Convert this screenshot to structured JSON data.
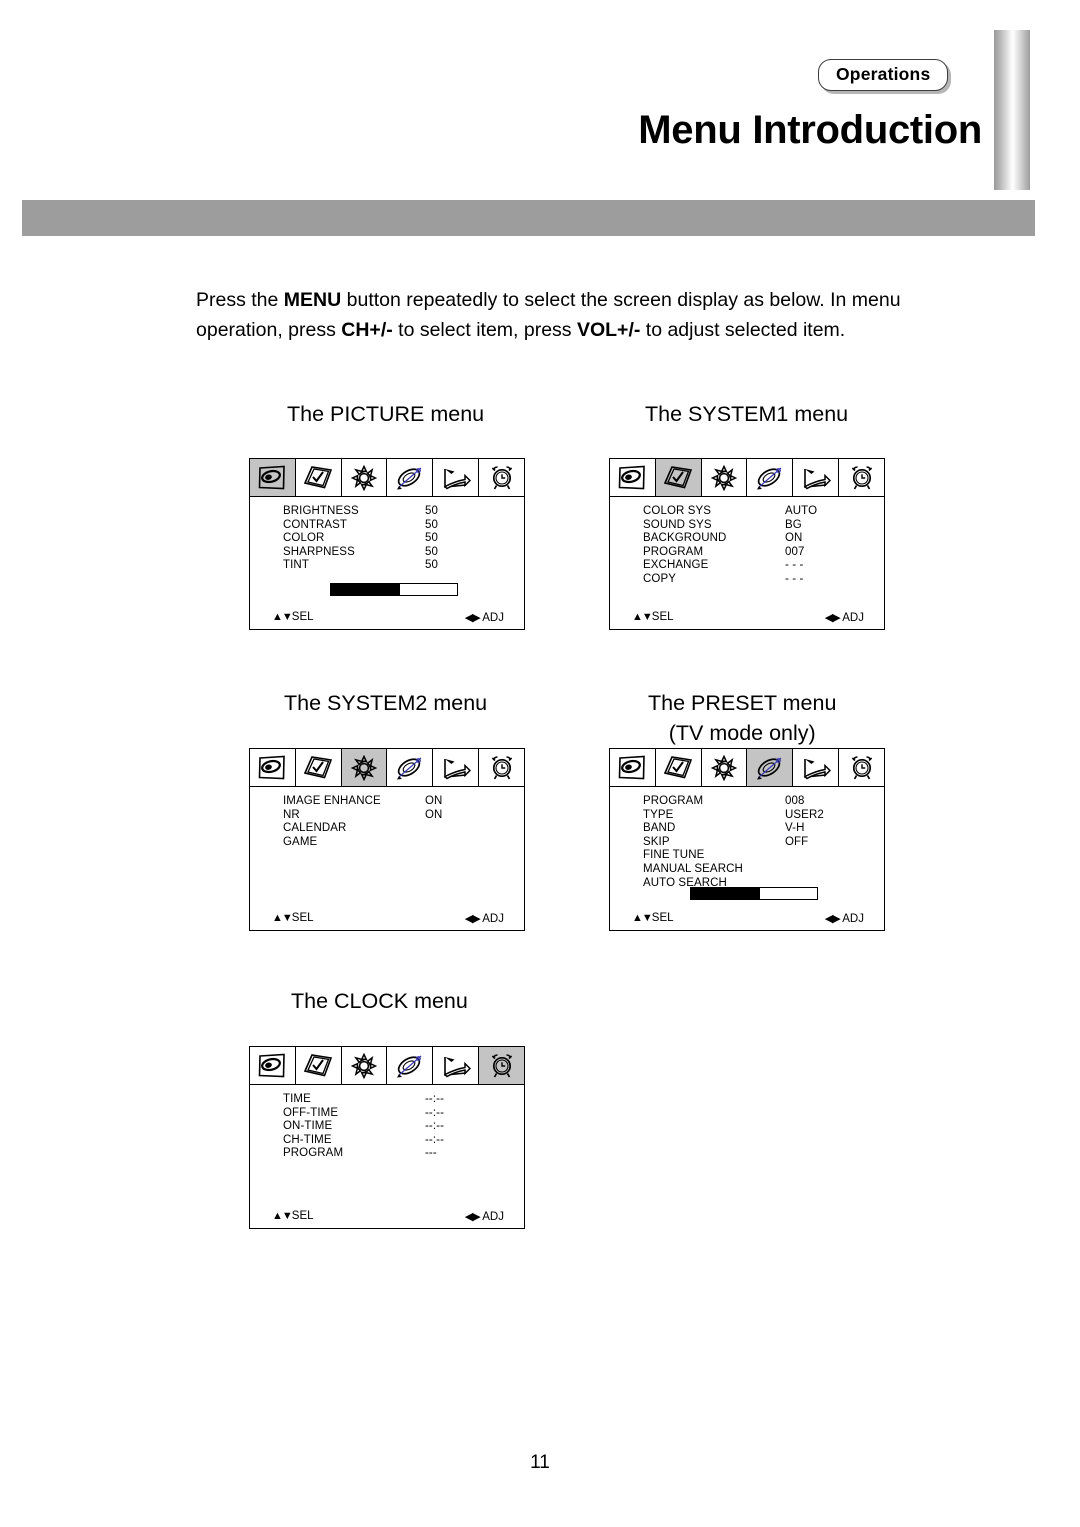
{
  "header": {
    "badge_label": "Operations",
    "title": "Menu Introduction"
  },
  "intro": {
    "line1_a": "Press the ",
    "line1_b": "MENU",
    "line1_c": " button repeatedly to select the screen display as below. In menu operation, press ",
    "line1_d": "CH+/-",
    "line1_e": " to select item, press ",
    "line1_f": "VOL+/-",
    "line1_g": " to adjust selected item."
  },
  "icons": [
    "picture-icon",
    "system1-icon",
    "system2-icon",
    "preset-icon",
    "arrow-icon",
    "clock-icon"
  ],
  "menus": {
    "picture": {
      "caption": "The PICTURE menu",
      "active_icon": 0,
      "rows": [
        {
          "label": "BRIGHTNESS",
          "value": "50"
        },
        {
          "label": "CONTRAST",
          "value": "50"
        },
        {
          "label": "COLOR",
          "value": "50"
        },
        {
          "label": "SHARPNESS",
          "value": "50"
        },
        {
          "label": "TINT",
          "value": "50"
        }
      ],
      "bar_percent": 55,
      "sel_label": "SEL",
      "adj_label": "ADJ"
    },
    "system1": {
      "caption": "The SYSTEM1 menu",
      "active_icon": 1,
      "rows": [
        {
          "label": "COLOR SYS",
          "value": "AUTO"
        },
        {
          "label": "SOUND SYS",
          "value": "BG"
        },
        {
          "label": "BACKGROUND",
          "value": "ON"
        },
        {
          "label": "PROGRAM",
          "value": "007"
        },
        {
          "label": "EXCHANGE",
          "value": "- - -"
        },
        {
          "label": "COPY",
          "value": "- - -"
        }
      ],
      "bar_percent": null,
      "sel_label": "SEL",
      "adj_label": "ADJ"
    },
    "system2": {
      "caption": "The SYSTEM2 menu",
      "active_icon": 2,
      "rows": [
        {
          "label": "IMAGE ENHANCE",
          "value": "ON"
        },
        {
          "label": "NR",
          "value": "ON"
        },
        {
          "label": "CALENDAR",
          "value": ""
        },
        {
          "label": "GAME",
          "value": ""
        }
      ],
      "bar_percent": null,
      "sel_label": "SEL",
      "adj_label": "ADJ"
    },
    "preset": {
      "caption": "The PRESET menu",
      "caption_sub": "(TV mode only)",
      "active_icon": 3,
      "rows": [
        {
          "label": "PROGRAM",
          "value": "008"
        },
        {
          "label": "TYPE",
          "value": "USER2"
        },
        {
          "label": "BAND",
          "value": "V-H"
        },
        {
          "label": "SKIP",
          "value": "OFF"
        },
        {
          "label": "FINE TUNE",
          "value": ""
        },
        {
          "label": "MANUAL SEARCH",
          "value": ""
        },
        {
          "label": "AUTO SEARCH",
          "value": ""
        }
      ],
      "bar_percent": 55,
      "sel_label": "SEL",
      "adj_label": "ADJ"
    },
    "clock": {
      "caption": "The CLOCK menu",
      "active_icon": 5,
      "rows": [
        {
          "label": "TIME",
          "value": "--:--"
        },
        {
          "label": "OFF-TIME",
          "value": "--:--"
        },
        {
          "label": "ON-TIME",
          "value": "--:--"
        },
        {
          "label": "CH-TIME",
          "value": "--:--"
        },
        {
          "label": "PROGRAM",
          "value": "---"
        }
      ],
      "bar_percent": null,
      "sel_label": "SEL",
      "adj_label": "ADJ"
    }
  },
  "footer": {
    "page_number": "11"
  }
}
